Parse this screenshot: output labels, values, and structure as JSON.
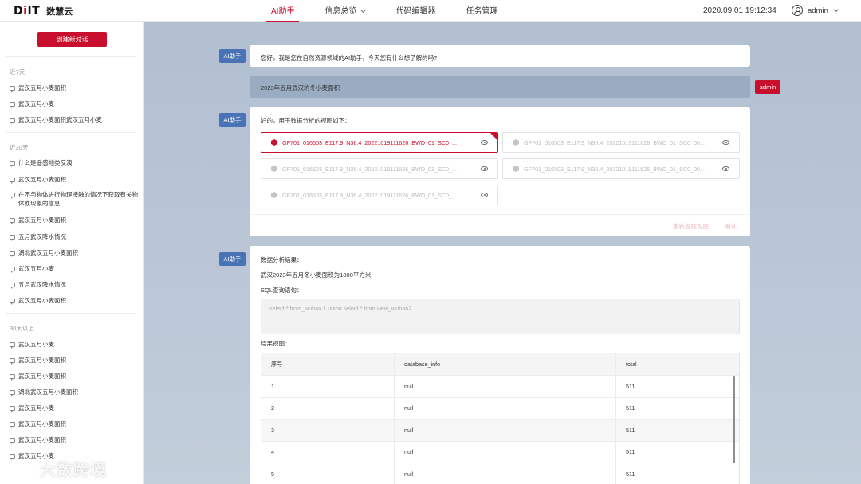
{
  "header": {
    "logo_mark_a": "D",
    "logo_mark_b": "i",
    "logo_mark_c": "IT",
    "logo_text": "数慧云",
    "nav": [
      {
        "label": "AI助手",
        "active": true
      },
      {
        "label": "信息总览",
        "dropdown": true
      },
      {
        "label": "代码编辑器"
      },
      {
        "label": "任务管理"
      }
    ],
    "datetime": "2020.09.01 19:12:34",
    "username": "admin"
  },
  "sidebar": {
    "new_chat_label": "创建新对话",
    "groups": [
      {
        "label": "近7天",
        "items": [
          "武汉五月小麦面积",
          "武汉五月小麦",
          "武汉五月小麦面积武汉五月小麦"
        ]
      },
      {
        "label": "近30天",
        "items": [
          "什么是遥感地类反演",
          "武汉五月小麦面积",
          "在不与物体进行物理接触的情况下获取有关物体或现象的信息",
          "武汉五月小麦面积",
          "五月武汉降水情况",
          "湖北武汉五月小麦面积",
          "武汉五月小麦",
          "五月武汉降水情况",
          "武汉五月小麦面积"
        ]
      },
      {
        "label": "30天以上",
        "items": [
          "武汉五月小麦",
          "武汉五月小麦面积",
          "武汉五月小麦面积",
          "湖北武汉五月小麦面积",
          "武汉五月小麦",
          "武汉五月小麦面积",
          "武汉五月小麦面积",
          "武汉五月小麦"
        ]
      }
    ]
  },
  "chat": {
    "ai_label": "AI助手",
    "greeting": "您好，我是您在自然资源领域的AI助手，今天您有什么想了解的吗?",
    "user_message": "2023年五月武汉的冬小麦面积",
    "user_label": "admin",
    "views_intro": "好的，用于数据分析的视图如下：",
    "files": [
      {
        "name": "GF701_016503_E117.9_N36.4_20221019111626_BWD_01_SC0_...",
        "selected": true
      },
      {
        "name": "GF701_016503_E117.9_N36.4_20221019111626_BWD_01_SC0_00...",
        "selected": false
      },
      {
        "name": "GF701_016503_E117.9_N36.4_20221019111626_BWD_01_SC0_...",
        "selected": false
      },
      {
        "name": "GF701_016503_E117.9_N36.4_20221019111626_BWD_01_SC0_00...",
        "selected": false
      },
      {
        "name": "GF701_016503_E117.9_N36.4_20221019111626_BWD_01_SC0_...",
        "selected": false
      }
    ],
    "requery_label": "重新查找视图",
    "confirm_label": "确认",
    "result_title": "数据分析结果：",
    "result_summary": "武汉2023年五月冬小麦面积为1000平方米",
    "sql_label": "SQL查询语句：",
    "sql_text": "select * from_wuhan 1 union select * from view_wuhan2",
    "result_view_label": "结果视图：",
    "table": {
      "columns": [
        "序号",
        "database_info",
        "total"
      ],
      "rows": [
        [
          "1",
          "null",
          "511"
        ],
        [
          "2",
          "null",
          "511"
        ],
        [
          "3",
          "null",
          "511"
        ],
        [
          "4",
          "null",
          "511"
        ],
        [
          "5",
          "null",
          "511"
        ]
      ]
    }
  },
  "watermark": "大数跨境"
}
